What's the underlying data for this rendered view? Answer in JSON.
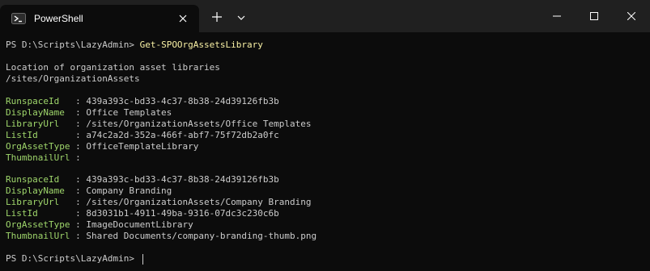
{
  "window": {
    "tab_title": "PowerShell",
    "icons": {
      "tab": "powershell-icon",
      "close_tab": "close-icon",
      "new_tab": "plus-icon",
      "dropdown": "chevron-down-icon",
      "minimize": "minimize-icon",
      "maximize": "maximize-icon",
      "close": "close-icon"
    },
    "colors": {
      "titlebar": "#202020",
      "background": "#0c0c0c",
      "text": "#cccccc",
      "command": "#f9f1a5",
      "property": "#9fd66b"
    }
  },
  "console": {
    "prompt1": "PS D:\\Scripts\\LazyAdmin> ",
    "command": "Get-SPOOrgAssetsLibrary",
    "header_line1": "Location of organization asset libraries",
    "header_line2": "/sites/OrganizationAssets",
    "records": [
      {
        "RunspaceId": "439a393c-bd33-4c37-8b38-24d39126fb3b",
        "DisplayName": "Office Templates",
        "LibraryUrl": "/sites/OrganizationAssets/Office Templates",
        "ListId": "a74c2a2d-352a-466f-abf7-75f72db2a0fc",
        "OrgAssetType": "OfficeTemplateLibrary",
        "ThumbnailUrl": ""
      },
      {
        "RunspaceId": "439a393c-bd33-4c37-8b38-24d39126fb3b",
        "DisplayName": "Company Branding",
        "LibraryUrl": "/sites/OrganizationAssets/Company Branding",
        "ListId": "8d3031b1-4911-49ba-9316-07dc3c230c6b",
        "OrgAssetType": "ImageDocumentLibrary",
        "ThumbnailUrl": "Shared Documents/company-branding-thumb.png"
      }
    ],
    "labels": {
      "RunspaceId": "RunspaceId   ",
      "DisplayName": "DisplayName  ",
      "LibraryUrl": "LibraryUrl   ",
      "ListId": "ListId       ",
      "OrgAssetType": "OrgAssetType ",
      "ThumbnailUrl": "ThumbnailUrl "
    },
    "separator": ": ",
    "prompt2": "PS D:\\Scripts\\LazyAdmin> "
  }
}
